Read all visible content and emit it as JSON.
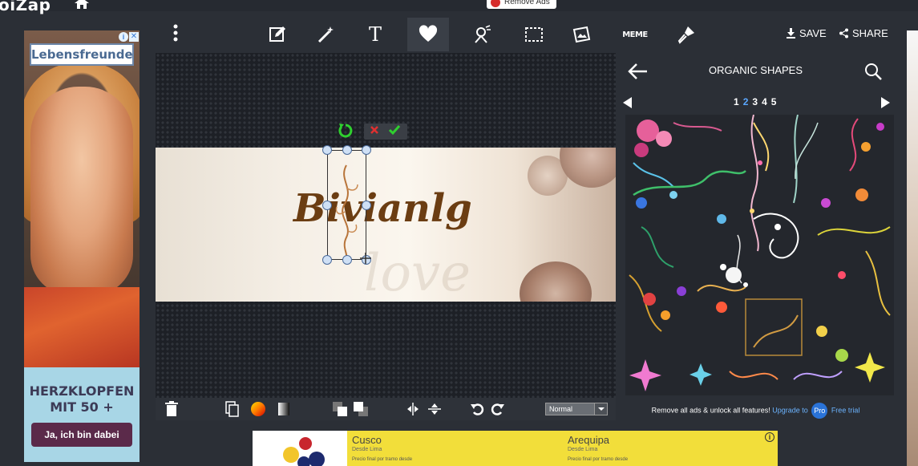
{
  "header": {
    "logo_text": "oiZap",
    "remove_ads_label": "Remove Ads"
  },
  "ad_left": {
    "brand": "Lebensfreunde",
    "info_symbol": "i",
    "close_symbol": "✕",
    "headline_line1": "HERZKLOPFEN",
    "headline_line2": "MIT 50 +",
    "cta": "Ja, ich bin dabei"
  },
  "toolbar": {
    "tools": [
      {
        "name": "edit-icon"
      },
      {
        "name": "magic-wand-icon"
      },
      {
        "name": "text-icon",
        "glyph": "T"
      },
      {
        "name": "heart-icon"
      },
      {
        "name": "cutout-icon"
      },
      {
        "name": "frame-icon"
      },
      {
        "name": "photo-add-icon"
      },
      {
        "name": "meme-icon",
        "glyph": "MEME"
      },
      {
        "name": "brush-icon"
      }
    ],
    "active_index": 3,
    "save_label": "SAVE",
    "share_label": "SHARE"
  },
  "canvas": {
    "text": "Bivianlg",
    "watermark": "love"
  },
  "bottom_toolbar": {
    "blend_mode": "Normal"
  },
  "panel": {
    "title": "ORGANIC SHAPES",
    "pages": [
      "1",
      "2",
      "3",
      "4",
      "5"
    ],
    "current_page": "2",
    "promo_text": "Remove all ads & unlock all features!",
    "promo_link": "Upgrade to",
    "pro_badge": "Pro",
    "promo_trial": "Free trial"
  },
  "ad_bottom": {
    "col1_city": "Cusco",
    "col1_sub": "Desde Lima",
    "col1_small": "Precio final por tramo desde",
    "col2_city": "Arequipa",
    "col2_sub": "Desde Lima",
    "col2_small": "Precio final por tramo desde",
    "info_symbol": "i"
  },
  "colors": {
    "background": "#2b2f36",
    "accent_blue": "#5ba8ff",
    "canvas_text": "#6b3d12",
    "confirm_green": "#2fd02f",
    "cancel_red": "#e03030"
  }
}
